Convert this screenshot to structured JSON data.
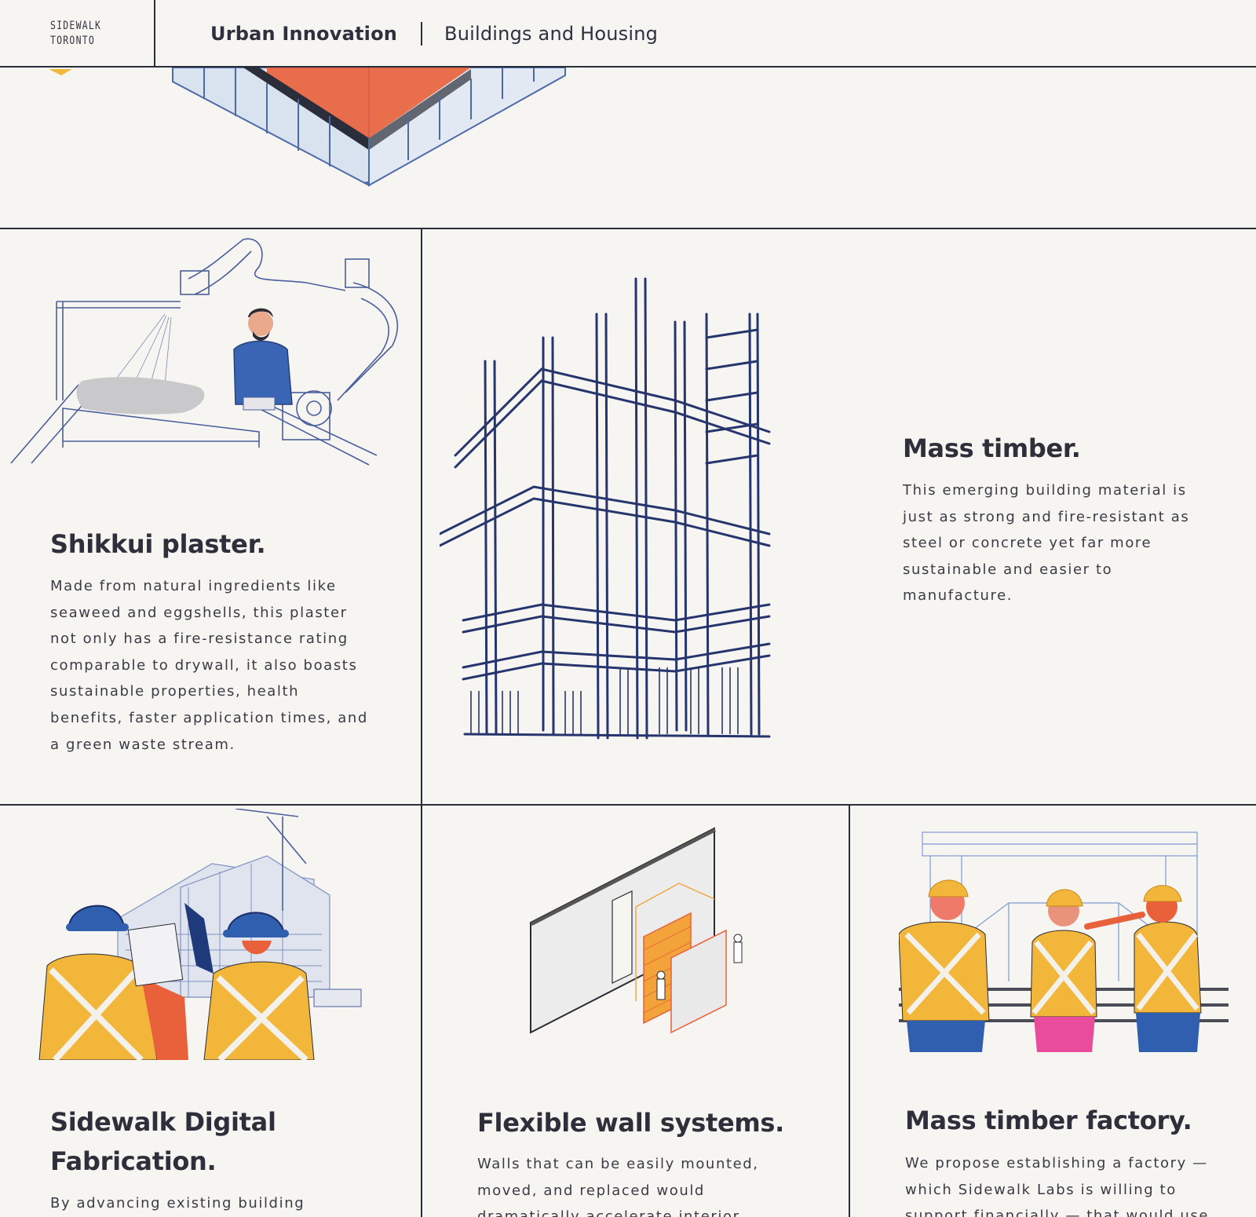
{
  "header": {
    "logo_line1": "SIDEWALK",
    "logo_line2": "TORONTO",
    "nav_primary": "Urban Innovation",
    "nav_secondary": "Buildings and Housing"
  },
  "cards": {
    "shikkui": {
      "title": "Shikkui plaster.",
      "body": "Made from natural ingredients like seaweed and eggshells, this plaster not only has a fire-resistance rating comparable to drywall, it also boasts sustainable properties, health benefits, faster application times, and a green waste stream."
    },
    "mass_timber": {
      "title": "Mass timber.",
      "body": "This emerging building material is just as strong and fire-resistant as steel or concrete yet far more sustainable and easier to manufacture."
    },
    "digital_fab": {
      "title": "Sidewalk Digital Fabrication.",
      "body": "By advancing existing building"
    },
    "flex_wall": {
      "title": "Flexible wall systems.",
      "body": "Walls that can be easily mounted, moved, and replaced would dramatically accelerate interior"
    },
    "factory": {
      "title": "Mass timber factory.",
      "body": "We propose establishing a factory — which Sidewalk Labs is willing to support financially — that would use"
    }
  },
  "colors": {
    "background": "#f7f5f1",
    "rule": "#2a2d3a",
    "ink_blue": "#2a3a7c",
    "safety_yellow": "#f2b63a",
    "accent_orange": "#e8613a"
  }
}
